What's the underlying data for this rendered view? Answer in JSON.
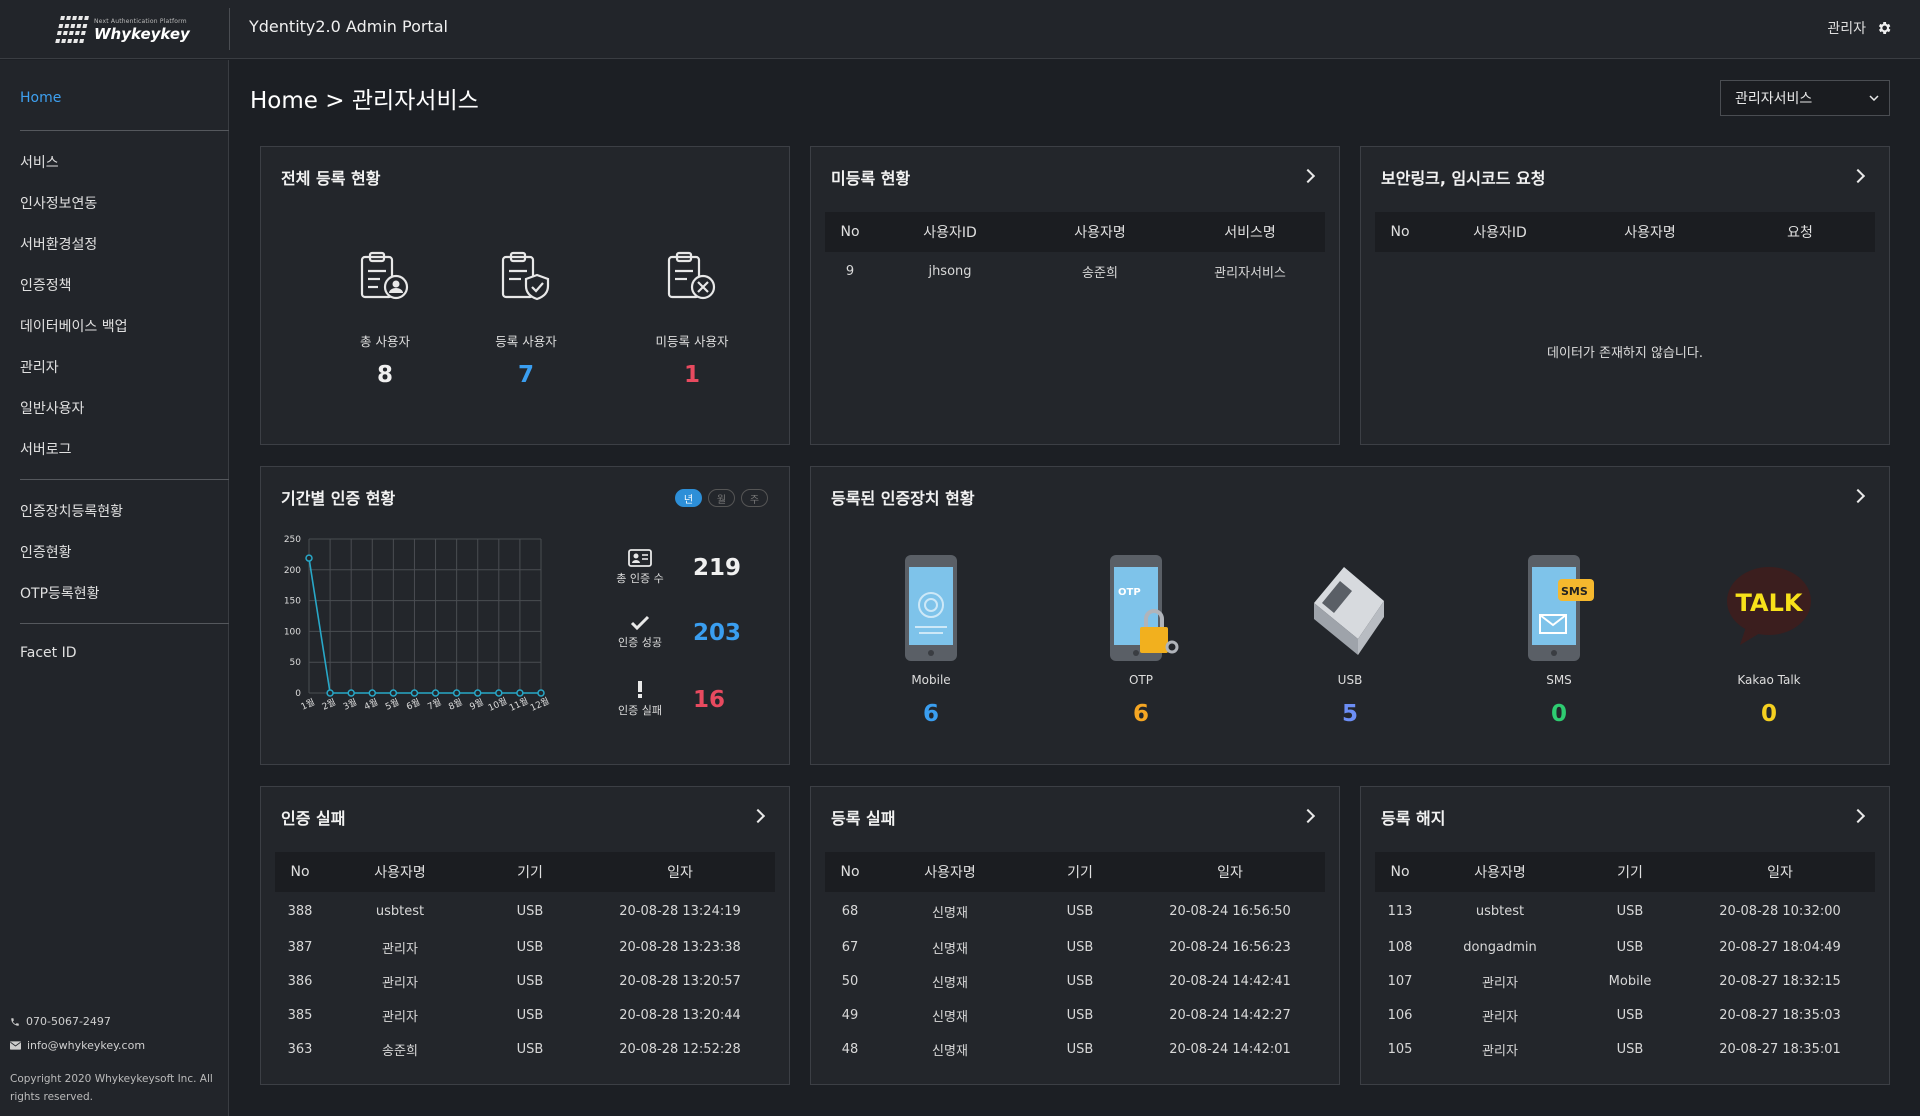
{
  "header": {
    "logo_tagline": "Next Authentication Platform",
    "logo_name": "Whykeykey",
    "app_title": "Ydentity2.0 Admin Portal",
    "user_label": "관리자"
  },
  "sidebar": {
    "home": "Home",
    "group1": [
      "서비스",
      "인사정보연동",
      "서버환경설정",
      "인증정책",
      "데이터베이스 백업",
      "관리자",
      "일반사용자",
      "서버로그"
    ],
    "group2": [
      "인증장치등록현황",
      "인증현황",
      "OTP등록현황"
    ],
    "group3": [
      "Facet ID"
    ],
    "phone": "070-5067-2497",
    "email": "info@whykeykey.com",
    "copyright": "Copyright 2020 Whykeykeysoft Inc. All rights reserved."
  },
  "breadcrumb": "Home > 관리자서비스",
  "service_select": "관리자서비스",
  "total_reg": {
    "title": "전체 등록 현황",
    "items": [
      {
        "label": "총 사용자",
        "value": "8"
      },
      {
        "label": "등록 사용자",
        "value": "7"
      },
      {
        "label": "미등록 사용자",
        "value": "1"
      }
    ]
  },
  "unreg": {
    "title": "미등록 현황",
    "headers": [
      "No",
      "사용자ID",
      "사용자명",
      "서비스명"
    ],
    "rows": [
      [
        "9",
        "jhsong",
        "송준희",
        "관리자서비스"
      ]
    ]
  },
  "seclink": {
    "title": "보안링크, 임시코드 요청",
    "headers": [
      "No",
      "사용자ID",
      "사용자명",
      "요청"
    ],
    "empty": "데이터가 존재하지 않습니다."
  },
  "period": {
    "title": "기간별 인증 현황",
    "toggles": [
      "년",
      "월",
      "주"
    ],
    "kpis": [
      {
        "label": "총 인증 수",
        "value": "219"
      },
      {
        "label": "인증 성공",
        "value": "203"
      },
      {
        "label": "인증 실패",
        "value": "16"
      }
    ]
  },
  "chart_data": {
    "type": "line",
    "categories": [
      "1월",
      "2월",
      "3월",
      "4월",
      "5월",
      "6월",
      "7월",
      "8월",
      "9월",
      "10월",
      "11월",
      "12월"
    ],
    "values": [
      219,
      0,
      0,
      0,
      0,
      0,
      0,
      0,
      0,
      0,
      0,
      0
    ],
    "ylim": [
      0,
      250
    ],
    "yticks": [
      "0",
      "50",
      "100",
      "150",
      "200",
      "250"
    ],
    "grid": true,
    "color": "#28a8c8"
  },
  "devices": {
    "title": "등록된 인증장치 현황",
    "items": [
      {
        "label": "Mobile",
        "value": "6",
        "color": "#3a9ef0",
        "icon": "mobile-fingerprint-icon"
      },
      {
        "label": "OTP",
        "value": "6",
        "color": "#f5a623",
        "icon": "otp-lock-icon"
      },
      {
        "label": "USB",
        "value": "5",
        "color": "#6c8ef5",
        "icon": "usb-key-icon"
      },
      {
        "label": "SMS",
        "value": "0",
        "color": "#2ecc71",
        "icon": "sms-phone-icon"
      },
      {
        "label": "Kakao Talk",
        "value": "0",
        "color": "#f5d020",
        "icon": "kakao-talk-icon"
      }
    ]
  },
  "auth_fail": {
    "title": "인증 실패",
    "headers": [
      "No",
      "사용자명",
      "기기",
      "일자"
    ],
    "rows": [
      [
        "388",
        "usbtest",
        "USB",
        "20-08-28 13:24:19"
      ],
      [
        "387",
        "관리자",
        "USB",
        "20-08-28 13:23:38"
      ],
      [
        "386",
        "관리자",
        "USB",
        "20-08-28 13:20:57"
      ],
      [
        "385",
        "관리자",
        "USB",
        "20-08-28 13:20:44"
      ],
      [
        "363",
        "송준희",
        "USB",
        "20-08-28 12:52:28"
      ]
    ]
  },
  "reg_fail": {
    "title": "등록 실패",
    "headers": [
      "No",
      "사용자명",
      "기기",
      "일자"
    ],
    "rows": [
      [
        "68",
        "신명재",
        "USB",
        "20-08-24 16:56:50"
      ],
      [
        "67",
        "신명재",
        "USB",
        "20-08-24 16:56:23"
      ],
      [
        "50",
        "신명재",
        "USB",
        "20-08-24 14:42:41"
      ],
      [
        "49",
        "신명재",
        "USB",
        "20-08-24 14:42:27"
      ],
      [
        "48",
        "신명재",
        "USB",
        "20-08-24 14:42:01"
      ]
    ]
  },
  "reg_cancel": {
    "title": "등록 해지",
    "headers": [
      "No",
      "사용자명",
      "기기",
      "일자"
    ],
    "rows": [
      [
        "113",
        "usbtest",
        "USB",
        "20-08-28 10:32:00"
      ],
      [
        "108",
        "dongadmin",
        "USB",
        "20-08-27 18:04:49"
      ],
      [
        "107",
        "관리자",
        "Mobile",
        "20-08-27 18:32:15"
      ],
      [
        "106",
        "관리자",
        "USB",
        "20-08-27 18:35:03"
      ],
      [
        "105",
        "관리자",
        "USB",
        "20-08-27 18:35:01"
      ]
    ]
  },
  "colors": {
    "blue": "#3a9ef0",
    "red": "#e84a5f",
    "white": "#f0f0f0"
  }
}
